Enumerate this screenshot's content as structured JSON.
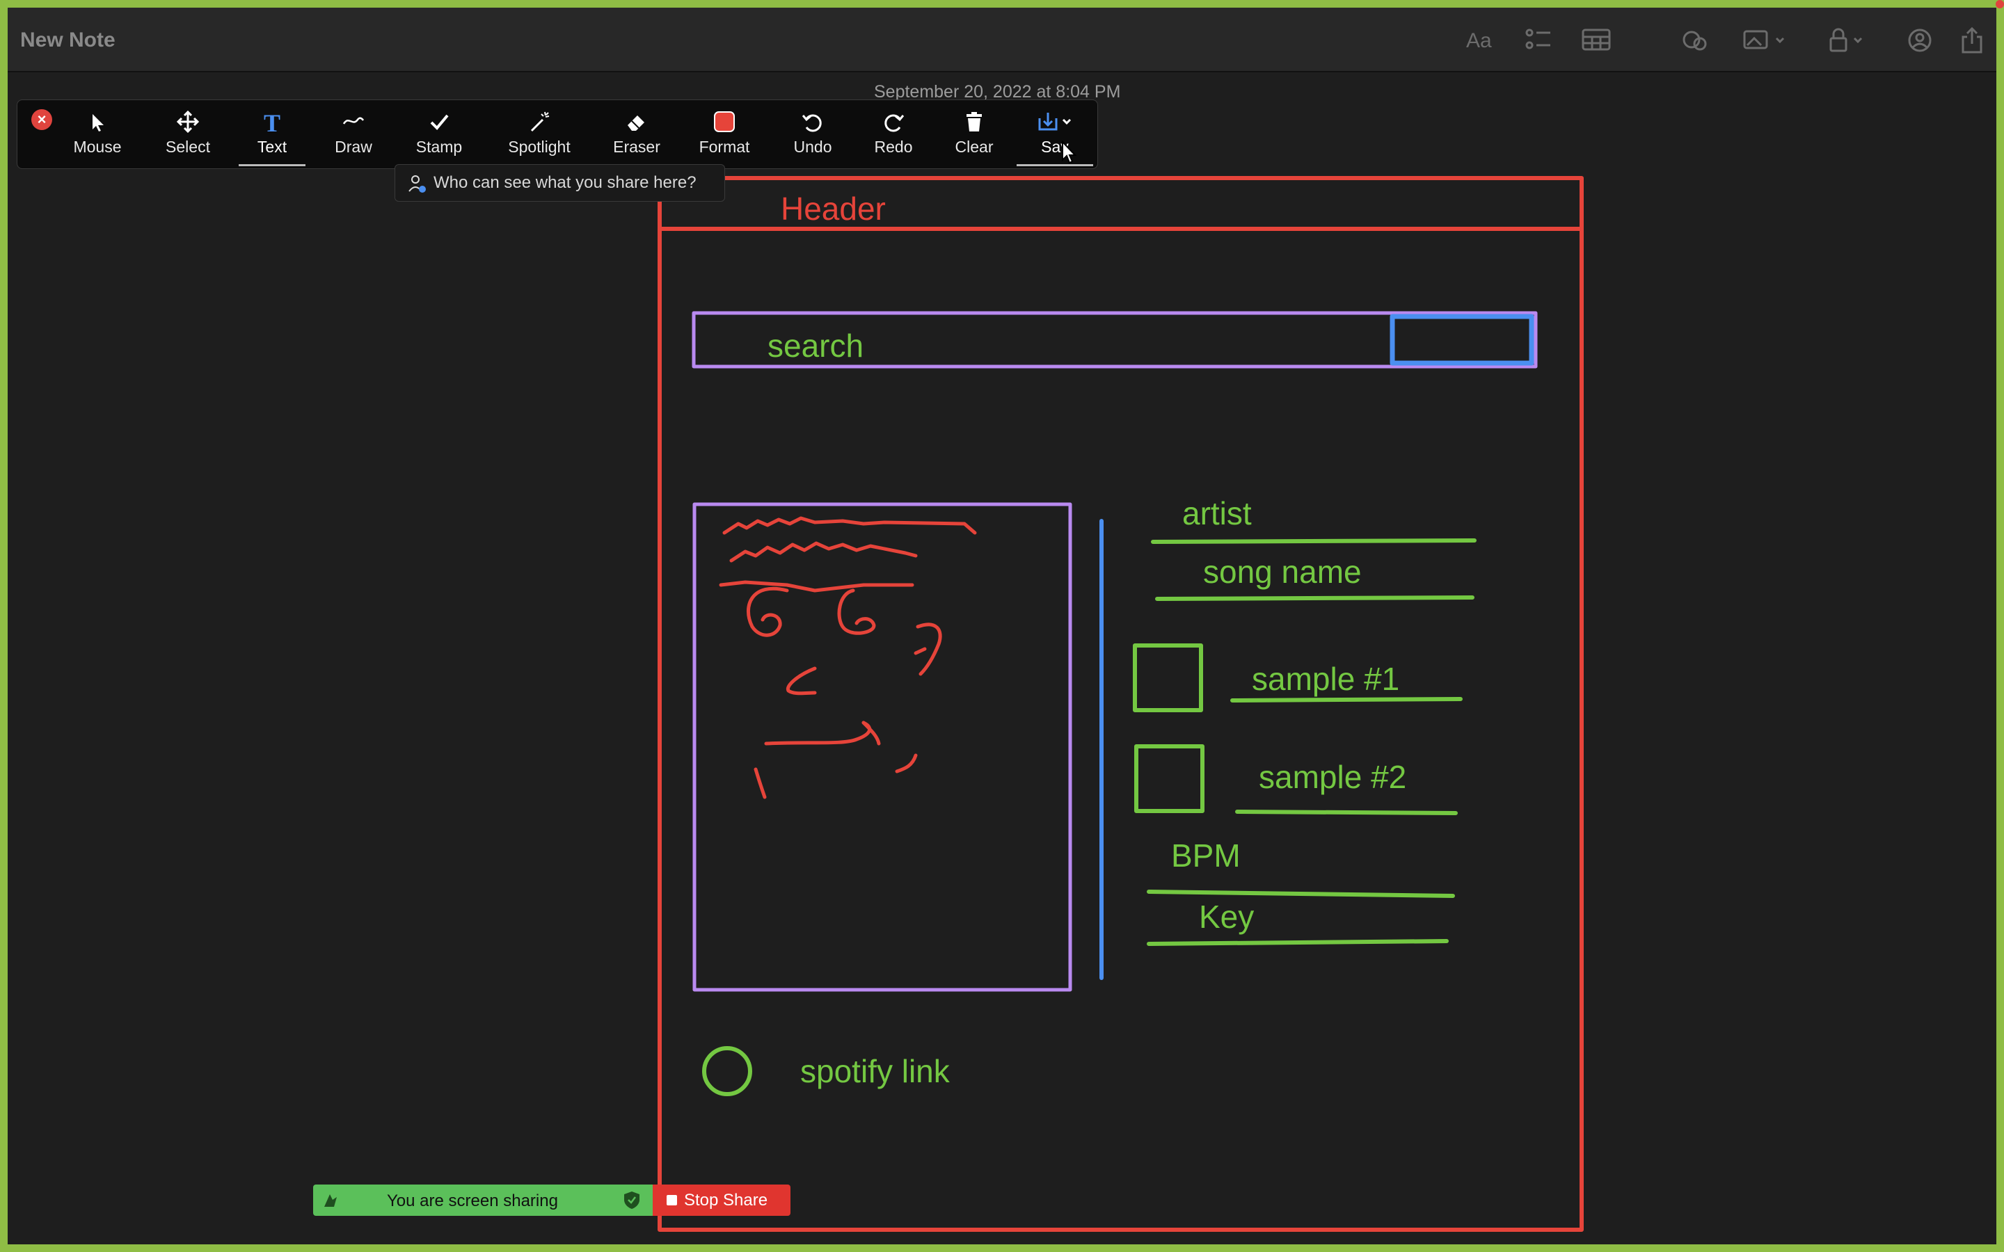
{
  "window": {
    "title": "New Note"
  },
  "note": {
    "date": "September 20, 2022 at 8:04 PM"
  },
  "titlebar_icons": [
    "text-format-icon",
    "checklist-icon",
    "table-icon",
    "collaborate-icon",
    "media-icon",
    "lock-icon",
    "share-person-icon",
    "share-icon"
  ],
  "annotation_toolbar": {
    "tools": [
      {
        "id": "mouse",
        "label": "Mouse",
        "icon": "arrow-cursor-icon"
      },
      {
        "id": "select",
        "label": "Select",
        "icon": "move-arrows-icon"
      },
      {
        "id": "text",
        "label": "Text",
        "icon": "text-t-icon",
        "active": true
      },
      {
        "id": "draw",
        "label": "Draw",
        "icon": "squiggle-icon"
      },
      {
        "id": "stamp",
        "label": "Stamp",
        "icon": "checkmark-icon"
      },
      {
        "id": "spotlight",
        "label": "Spotlight",
        "icon": "magic-wand-icon"
      },
      {
        "id": "eraser",
        "label": "Eraser",
        "icon": "eraser-icon"
      },
      {
        "id": "format",
        "label": "Format",
        "icon": "color-swatch-icon"
      },
      {
        "id": "undo",
        "label": "Undo",
        "icon": "undo-icon"
      },
      {
        "id": "redo",
        "label": "Redo",
        "icon": "redo-icon"
      },
      {
        "id": "clear",
        "label": "Clear",
        "icon": "trash-icon"
      },
      {
        "id": "save",
        "label": "Sav",
        "icon": "save-download-icon",
        "active": true
      }
    ],
    "who_can_see": "Who can see what you share here?",
    "format_color": "#e6443a"
  },
  "sketch": {
    "header_label": "Header",
    "search_label": "search",
    "artist_label": "artist",
    "song_name_label": "song name",
    "sample1_label": "sample #1",
    "sample2_label": "sample #2",
    "bpm_label": "BPM",
    "key_label": "Key",
    "spotify_label": "spotify link",
    "colors": {
      "red": "#e6443a",
      "green": "#74c842",
      "purple": "#b98af0",
      "blue": "#4b8ff0"
    }
  },
  "share_bar": {
    "status": "You are screen sharing",
    "stop_label": "Stop Share"
  }
}
